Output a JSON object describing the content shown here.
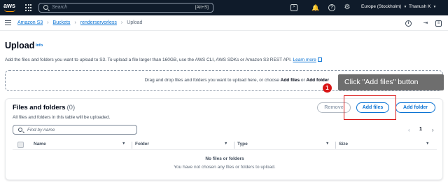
{
  "topnav": {
    "logo_text": "aws",
    "search_placeholder": "Search",
    "search_shortcut": "[Alt+S]",
    "region": "Europe (Stockholm)",
    "account": "Thanush K"
  },
  "breadcrumb": {
    "items": [
      "Amazon S3",
      "Buckets",
      "renderservorless"
    ],
    "current": "Upload"
  },
  "page": {
    "title": "Upload",
    "info": "Info",
    "description": "Add the files and folders you want to upload to S3. To upload a file larger than 160GB, use the AWS CLI, AWS SDKs or Amazon S3 REST API.",
    "learn_more": "Learn more"
  },
  "dropzone": {
    "text_prefix": "Drag and drop files and folders you want to upload here, or choose ",
    "bold1": "Add files",
    "middle": " or ",
    "bold2": "Add folder"
  },
  "callout": {
    "step": "1",
    "text": "Click \"Add files\" button"
  },
  "files_panel": {
    "title": "Files and folders",
    "count": "(0)",
    "subtitle": "All files and folders in this table will be uploaded.",
    "buttons": {
      "remove": "Remove",
      "add_files": "Add files",
      "add_folder": "Add folder"
    },
    "find_placeholder": "Find by name",
    "page_number": "1",
    "columns": [
      "Name",
      "Folder",
      "Type",
      "Size"
    ],
    "empty_title": "No files or folders",
    "empty_subtitle": "You have not chosen any files or folders to upload."
  },
  "colors": {
    "nav_bg": "#0f1b2a",
    "link": "#0972d3",
    "callout_bg": "#6a6a6a",
    "highlight": "#d91515"
  },
  "icons": [
    "aws-logo",
    "apps-grid-icon",
    "search-icon",
    "cloudshell-icon",
    "bell-icon",
    "help-icon",
    "gear-icon",
    "menu-icon",
    "info-icon",
    "exit-icon",
    "panel-icon",
    "external-link-icon",
    "chevron-left-icon",
    "chevron-right-icon",
    "sort-icon"
  ]
}
